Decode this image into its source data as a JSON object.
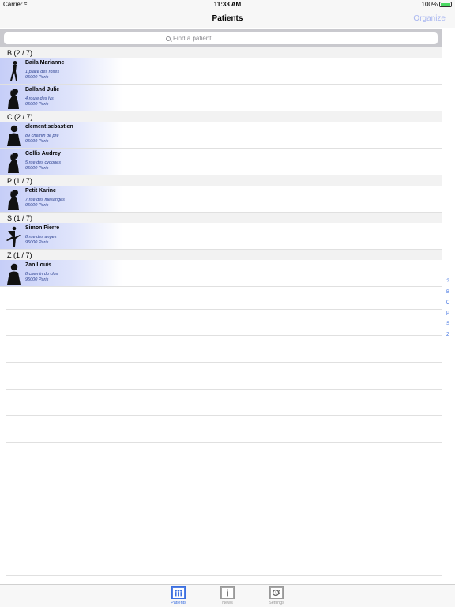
{
  "status": {
    "carrier": "Carrier",
    "time": "11:33 AM",
    "battery": "100%"
  },
  "nav": {
    "title": "Patients",
    "organize": "Organize"
  },
  "search": {
    "placeholder": "Find a patient"
  },
  "sections": [
    {
      "header": "B   (2 / 7)",
      "rows": [
        {
          "name": "Baila Marianne",
          "addr1": "1 place des roses",
          "addr2": "95000 Paris",
          "avatar": "woman-walking-icon"
        },
        {
          "name": "Balland Julie",
          "addr1": "4 route des lys",
          "addr2": "95000 Paris",
          "avatar": "woman-silhouette-icon"
        }
      ]
    },
    {
      "header": "C   (2 / 7)",
      "rows": [
        {
          "name": "clement sebastien",
          "addr1": "89 chemin de pre",
          "addr2": "95099 Paris",
          "avatar": "man-silhouette-icon"
        },
        {
          "name": "Collis Audrey",
          "addr1": "5 rue des cygones",
          "addr2": "95000 Paris",
          "avatar": "woman-silhouette-icon"
        }
      ]
    },
    {
      "header": "P   (1 / 7)",
      "rows": [
        {
          "name": "Petit Karine",
          "addr1": "7 rue des mesanges",
          "addr2": "95000 Paris",
          "avatar": "woman-silhouette-icon"
        }
      ]
    },
    {
      "header": "S   (1 / 7)",
      "rows": [
        {
          "name": "Simon Pierre",
          "addr1": "8 rue des anges",
          "addr2": "95000 Paris",
          "avatar": "dancer-icon"
        }
      ]
    },
    {
      "header": "Z   (1 / 7)",
      "rows": [
        {
          "name": "Zan Louis",
          "addr1": "8 chemin du clos",
          "addr2": "95000 Paris",
          "avatar": "man-silhouette-icon"
        }
      ]
    }
  ],
  "index": [
    "?",
    "B",
    "C",
    "P",
    "S",
    "Z"
  ],
  "tabs": [
    {
      "label": "Patients",
      "icon": "patients-icon",
      "active": true
    },
    {
      "label": "News",
      "icon": "news-icon",
      "active": false
    },
    {
      "label": "Settings",
      "icon": "settings-icon",
      "active": false
    }
  ],
  "colors": {
    "accent": "#3b6fe0",
    "organize": "#a8b6f0",
    "row_gradient": "#c6cef8"
  }
}
